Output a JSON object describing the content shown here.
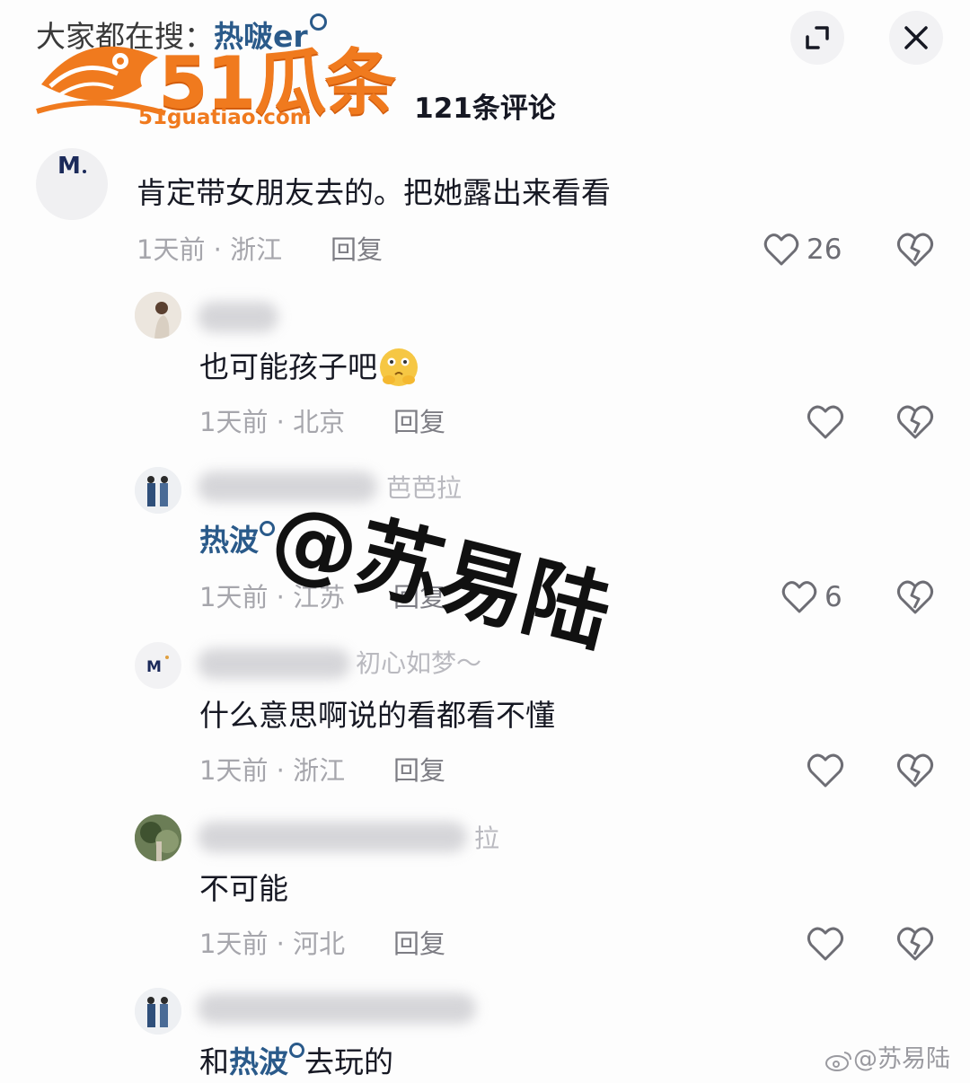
{
  "header": {
    "search_prefix": "大家都在搜：",
    "search_keyword": "热啵er",
    "comment_count": "121条评论"
  },
  "watermark": {
    "logo_text": "51瓜条",
    "logo_url": "51guatiao.com",
    "stamp": "@苏易陆",
    "weibo": "@苏易陆"
  },
  "comments": [
    {
      "text": "肯定带女朋友去的。把她露出来看看",
      "meta": "1天前 · 浙江",
      "reply": "回复",
      "likes": "26"
    },
    {
      "text": "也可能孩子吧",
      "meta": "1天前 · 北京",
      "reply": "回复",
      "likes": ""
    },
    {
      "username_tail": "芭芭拉",
      "keyword": "热波",
      "meta": "1天前 · 江苏",
      "reply": "回复",
      "likes": "6"
    },
    {
      "username_tail": "初心如梦～",
      "text": "什么意思啊说的看都看不懂",
      "meta": "1天前 · 浙江",
      "reply": "回复",
      "likes": ""
    },
    {
      "username_tail": "拉",
      "text": "不可能",
      "meta": "1天前 · 河北",
      "reply": "回复",
      "likes": ""
    },
    {
      "text_before": "和",
      "keyword": "热波",
      "text_after": "去玩的"
    }
  ],
  "colors": {
    "keyword_blue": "#2a5a8a",
    "logo_orange": "#f07a1e",
    "meta_gray": "#a6a6ac"
  },
  "icons": [
    "expand-icon",
    "close-icon",
    "heart-icon",
    "broken-heart-icon",
    "search-icon"
  ]
}
